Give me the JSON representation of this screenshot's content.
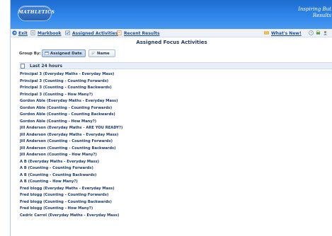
{
  "header": {
    "logo_text": "MATHLETICS",
    "tagline_line1": "Inspiring But",
    "tagline_line2": "Results"
  },
  "nav": {
    "exit": "Exit",
    "markbook": "Markbook",
    "assigned_activities": "Assigned Activities",
    "recent_results": "Recent Results",
    "whats_new": "What's New!"
  },
  "page_title": "Assigned Focus Activities",
  "group_by": {
    "label": "Group By:",
    "assigned_date": "Assigned Date",
    "name": "Name"
  },
  "section": {
    "title": "Last 24 hours"
  },
  "rows": [
    "Principal 3 (Everyday Maths - Everyday Mass)",
    "Principal 3 (Counting - Counting Forwards)",
    "Principal 3 (Counting - Counting Backwards)",
    "Principal 3 (Counting - How Many?)",
    "Gordon Able (Everyday Maths - Everyday Mass)",
    "Gordon Able (Counting - Counting Forwards)",
    "Gordon Able (Counting - Counting Backwards)",
    "Gordon Able (Counting - How Many?)",
    "Jill Anderson (Everyday Maths - ARE YOU READY?)",
    "Jill Anderson (Everyday Maths - Everyday Mass)",
    "Jill Anderson (Counting - Counting Forwards)",
    "Jill Anderson (Counting - Counting Backwards)",
    "Jill Anderson (Counting - How Many?)",
    "A B (Everyday Maths - Everyday Mass)",
    "A B (Counting - Counting Forwards)",
    "A B (Counting - Counting Backwards)",
    "A B (Counting - How Many?)",
    "Fred blogg (Everyday Maths - Everyday Mass)",
    "Fred blogg (Counting - Counting Forwards)",
    "Fred blogg (Counting - Counting Backwards)",
    "Fred blogg (Counting - How Many?)",
    "Cedric Carrol (Everyday Maths - Everyday Mass)"
  ]
}
